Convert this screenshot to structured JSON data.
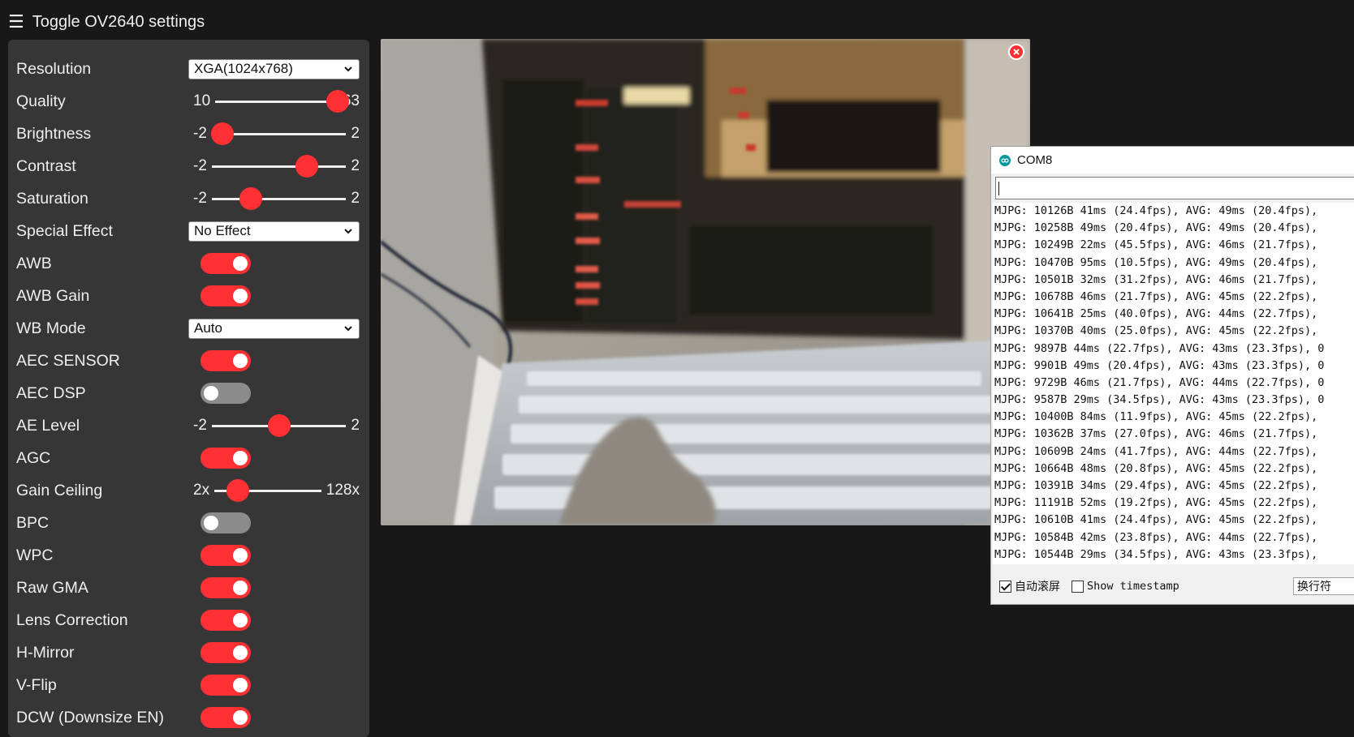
{
  "header": {
    "menu_icon": "hamburger-icon",
    "title": "Toggle OV2640 settings"
  },
  "settings": {
    "resolution": {
      "label": "Resolution",
      "value": "XGA(1024x768)"
    },
    "quality": {
      "label": "Quality",
      "min": "10",
      "max": "63",
      "value": 63
    },
    "brightness": {
      "label": "Brightness",
      "min": "-2",
      "max": "2",
      "value": -2
    },
    "contrast": {
      "label": "Contrast",
      "min": "-2",
      "max": "2",
      "value": 1
    },
    "saturation": {
      "label": "Saturation",
      "min": "-2",
      "max": "2",
      "value": -1
    },
    "special_effect": {
      "label": "Special Effect",
      "value": "No Effect"
    },
    "awb": {
      "label": "AWB",
      "on": true
    },
    "awb_gain": {
      "label": "AWB Gain",
      "on": true
    },
    "wb_mode": {
      "label": "WB Mode",
      "value": "Auto"
    },
    "aec_sensor": {
      "label": "AEC SENSOR",
      "on": true
    },
    "aec_dsp": {
      "label": "AEC DSP",
      "on": false
    },
    "ae_level": {
      "label": "AE Level",
      "min": "-2",
      "max": "2",
      "value": 0
    },
    "agc": {
      "label": "AGC",
      "on": true
    },
    "gain_ceiling": {
      "label": "Gain Ceiling",
      "min": "2x",
      "max": "128x",
      "value": 2
    },
    "bpc": {
      "label": "BPC",
      "on": false
    },
    "wpc": {
      "label": "WPC",
      "on": true
    },
    "raw_gma": {
      "label": "Raw GMA",
      "on": true
    },
    "lens_correction": {
      "label": "Lens Correction",
      "on": true
    },
    "hmirror": {
      "label": "H-Mirror",
      "on": true
    },
    "vflip": {
      "label": "V-Flip",
      "on": true
    },
    "dcw": {
      "label": "DCW (Downsize EN)",
      "on": true
    }
  },
  "colors": {
    "accent": "#ff3034",
    "panel": "#363636",
    "background": "#181818",
    "toggle_off": "#8b8b8b"
  },
  "serial_monitor": {
    "title": "COM8",
    "lines": [
      "MJPG: 10126B 41ms (24.4fps), AVG: 49ms (20.4fps),",
      "MJPG: 10258B 49ms (20.4fps), AVG: 49ms (20.4fps),",
      "MJPG: 10249B 22ms (45.5fps), AVG: 46ms (21.7fps),",
      "MJPG: 10470B 95ms (10.5fps), AVG: 49ms (20.4fps),",
      "MJPG: 10501B 32ms (31.2fps), AVG: 46ms (21.7fps),",
      "MJPG: 10678B 46ms (21.7fps), AVG: 45ms (22.2fps),",
      "MJPG: 10641B 25ms (40.0fps), AVG: 44ms (22.7fps),",
      "MJPG: 10370B 40ms (25.0fps), AVG: 45ms (22.2fps),",
      "MJPG: 9897B 44ms (22.7fps), AVG: 43ms (23.3fps), 0",
      "MJPG: 9901B 49ms (20.4fps), AVG: 43ms (23.3fps), 0",
      "MJPG: 9729B 46ms (21.7fps), AVG: 44ms (22.7fps), 0",
      "MJPG: 9587B 29ms (34.5fps), AVG: 43ms (23.3fps), 0",
      "MJPG: 10400B 84ms (11.9fps), AVG: 45ms (22.2fps),",
      "MJPG: 10362B 37ms (27.0fps), AVG: 46ms (21.7fps),",
      "MJPG: 10609B 24ms (41.7fps), AVG: 44ms (22.7fps),",
      "MJPG: 10664B 48ms (20.8fps), AVG: 45ms (22.2fps),",
      "MJPG: 10391B 34ms (29.4fps), AVG: 45ms (22.2fps),",
      "MJPG: 11191B 52ms (19.2fps), AVG: 45ms (22.2fps),",
      "MJPG: 10610B 41ms (24.4fps), AVG: 45ms (22.2fps),",
      "MJPG: 10584B 42ms (23.8fps), AVG: 44ms (22.7fps),",
      "MJPG: 10544B 29ms (34.5fps), AVG: 43ms (23.3fps),"
    ],
    "autoscroll_label": "自动滚屏",
    "autoscroll_checked": true,
    "timestamp_label": "Show timestamp",
    "timestamp_checked": false,
    "line_ending": "换行符"
  }
}
